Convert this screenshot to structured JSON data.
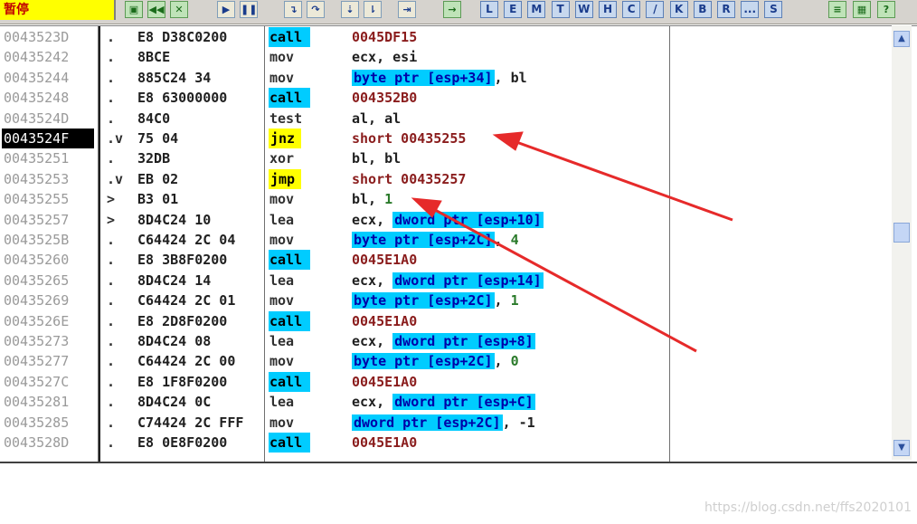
{
  "toolbar": {
    "status": "暂停",
    "letter_buttons": [
      "L",
      "E",
      "M",
      "T",
      "W",
      "H",
      "C",
      "/",
      "K",
      "B",
      "R",
      "...",
      "S"
    ]
  },
  "colors": {
    "call_bg": "#00ccff",
    "jump_bg": "#ffff00",
    "status_bg": "#ffff00",
    "arrow": "#e62a2a"
  },
  "rows": [
    {
      "addr": "0043523D",
      "mark": ".",
      "hex": "E8 D38C0200",
      "mn": "call",
      "op": [
        {
          "t": "0045DF15",
          "c": "addrop"
        }
      ]
    },
    {
      "addr": "00435242",
      "mark": ".",
      "hex": "8BCE",
      "mn": "mov",
      "op": [
        {
          "t": "ecx, esi"
        }
      ]
    },
    {
      "addr": "00435244",
      "mark": ".",
      "hex": "885C24 34",
      "mn": "mov",
      "op": [
        {
          "t": "byte ptr [esp+34]",
          "c": "mem"
        },
        {
          "t": ", bl"
        }
      ]
    },
    {
      "addr": "00435248",
      "mark": ".",
      "hex": "E8 63000000",
      "mn": "call",
      "op": [
        {
          "t": "004352B0",
          "c": "addrop"
        }
      ]
    },
    {
      "addr": "0043524D",
      "mark": ".",
      "hex": "84C0",
      "mn": "test",
      "op": [
        {
          "t": "al, al"
        }
      ]
    },
    {
      "addr": "0043524F",
      "mark": ".v",
      "hex": "75 04",
      "mn": "jnz",
      "sel": true,
      "op": [
        {
          "t": "short 00435255",
          "c": "addrop"
        }
      ]
    },
    {
      "addr": "00435251",
      "mark": ".",
      "hex": "32DB",
      "mn": "xor",
      "op": [
        {
          "t": "bl, bl"
        }
      ]
    },
    {
      "addr": "00435253",
      "mark": ".v",
      "hex": "EB 02",
      "mn": "jmp",
      "op": [
        {
          "t": "short 00435257",
          "c": "addrop"
        }
      ]
    },
    {
      "addr": "00435255",
      "mark": ">",
      "hex": "B3 01",
      "mn": "mov",
      "op": [
        {
          "t": "bl, "
        },
        {
          "t": "1",
          "c": "num"
        }
      ]
    },
    {
      "addr": "00435257",
      "mark": ">",
      "hex": "8D4C24 10",
      "mn": "lea",
      "op": [
        {
          "t": "ecx, "
        },
        {
          "t": "dword ptr [esp+10]",
          "c": "mem"
        }
      ]
    },
    {
      "addr": "0043525B",
      "mark": ".",
      "hex": "C64424 2C 04",
      "mn": "mov",
      "op": [
        {
          "t": "byte ptr [esp+2C]",
          "c": "mem"
        },
        {
          "t": ", "
        },
        {
          "t": "4",
          "c": "num"
        }
      ]
    },
    {
      "addr": "00435260",
      "mark": ".",
      "hex": "E8 3B8F0200",
      "mn": "call",
      "op": [
        {
          "t": "0045E1A0",
          "c": "addrop"
        }
      ]
    },
    {
      "addr": "00435265",
      "mark": ".",
      "hex": "8D4C24 14",
      "mn": "lea",
      "op": [
        {
          "t": "ecx, "
        },
        {
          "t": "dword ptr [esp+14]",
          "c": "mem"
        }
      ]
    },
    {
      "addr": "00435269",
      "mark": ".",
      "hex": "C64424 2C 01",
      "mn": "mov",
      "op": [
        {
          "t": "byte ptr [esp+2C]",
          "c": "mem"
        },
        {
          "t": ", "
        },
        {
          "t": "1",
          "c": "num"
        }
      ]
    },
    {
      "addr": "0043526E",
      "mark": ".",
      "hex": "E8 2D8F0200",
      "mn": "call",
      "op": [
        {
          "t": "0045E1A0",
          "c": "addrop"
        }
      ]
    },
    {
      "addr": "00435273",
      "mark": ".",
      "hex": "8D4C24 08",
      "mn": "lea",
      "op": [
        {
          "t": "ecx, "
        },
        {
          "t": "dword ptr [esp+8]",
          "c": "mem"
        }
      ]
    },
    {
      "addr": "00435277",
      "mark": ".",
      "hex": "C64424 2C 00",
      "mn": "mov",
      "op": [
        {
          "t": "byte ptr [esp+2C]",
          "c": "mem"
        },
        {
          "t": ", "
        },
        {
          "t": "0",
          "c": "num"
        }
      ]
    },
    {
      "addr": "0043527C",
      "mark": ".",
      "hex": "E8 1F8F0200",
      "mn": "call",
      "op": [
        {
          "t": "0045E1A0",
          "c": "addrop"
        }
      ]
    },
    {
      "addr": "00435281",
      "mark": ".",
      "hex": "8D4C24 0C",
      "mn": "lea",
      "op": [
        {
          "t": "ecx, "
        },
        {
          "t": "dword ptr [esp+C]",
          "c": "mem"
        }
      ]
    },
    {
      "addr": "00435285",
      "mark": ".",
      "hex": "C74424 2C FFF",
      "mn": "mov",
      "op": [
        {
          "t": "dword ptr [esp+2C]",
          "c": "mem"
        },
        {
          "t": ", -1"
        }
      ]
    },
    {
      "addr": "0043528D",
      "mark": ".",
      "hex": "E8 0E8F0200",
      "mn": "call",
      "op": [
        {
          "t": "0045E1A0",
          "c": "addrop"
        }
      ]
    }
  ],
  "watermark": "https://blog.csdn.net/ffs2020101"
}
